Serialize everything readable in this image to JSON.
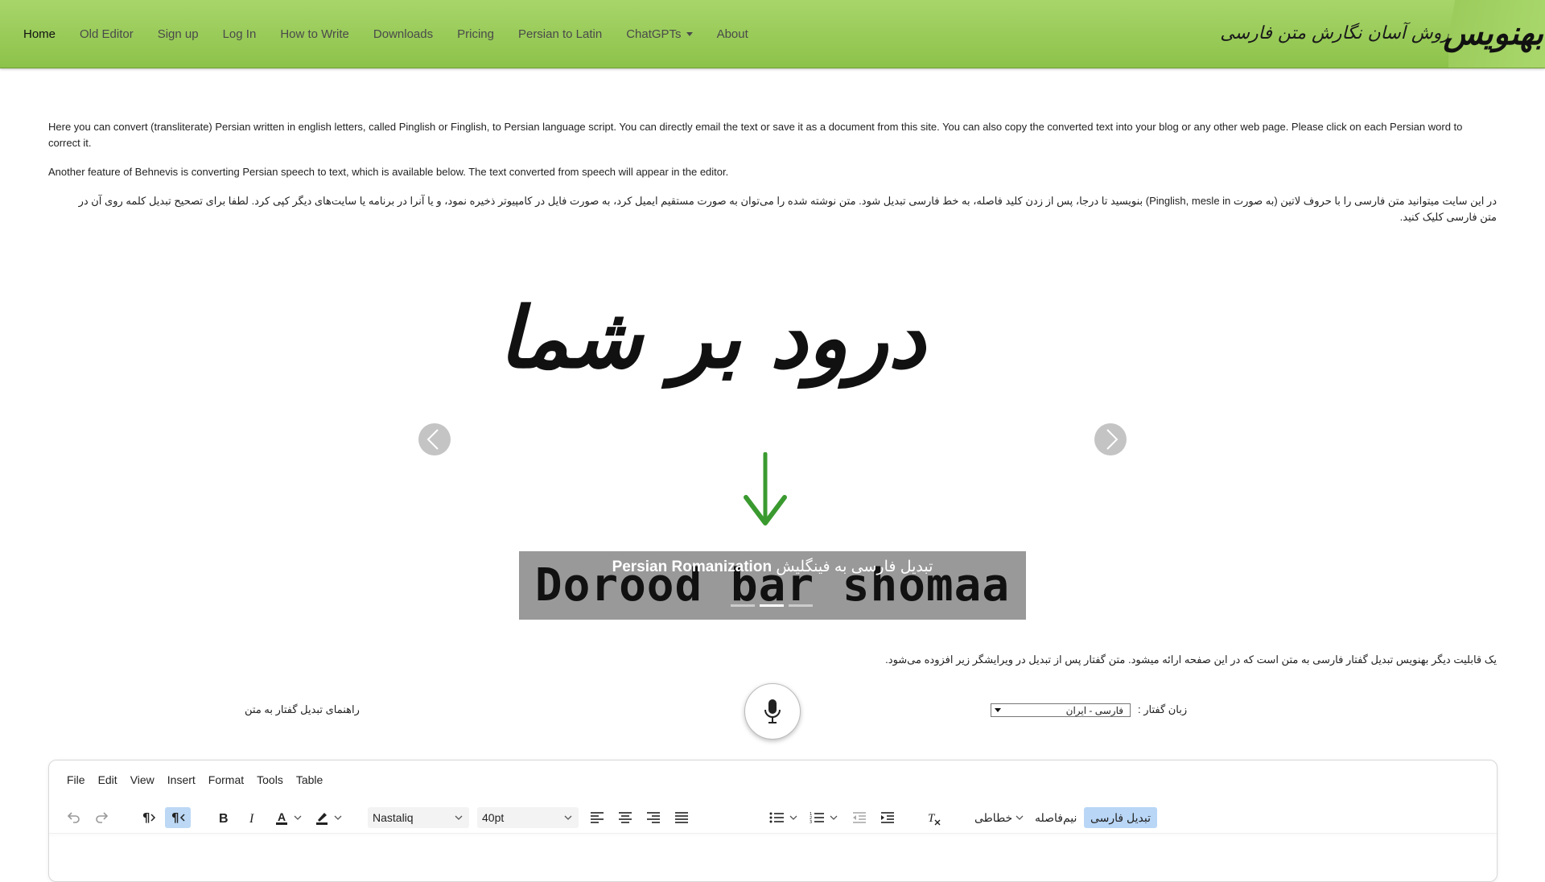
{
  "nav": {
    "items": [
      {
        "label": "Home",
        "active": true
      },
      {
        "label": "Old Editor"
      },
      {
        "label": "Sign up"
      },
      {
        "label": "Log In"
      },
      {
        "label": "How to Write"
      },
      {
        "label": "Downloads"
      },
      {
        "label": "Pricing"
      },
      {
        "label": "Persian to Latin"
      },
      {
        "label": "ChatGPTs"
      },
      {
        "label": "About"
      }
    ],
    "brand_tagline": "روش آسان نگارش متن فارسی",
    "brand_logo": "بهنویس"
  },
  "intro": {
    "en_paragraph_1": "Here you can convert (transliterate) Persian written in english letters, called Pinglish or Finglish, to Persian language script. You can directly email the text or save it as a document from this site. You can also copy the converted text into your blog or any other web page. Please click on each Persian word to correct it.",
    "en_paragraph_2": "Another feature of Behnevis is converting Persian speech to text, which is available below. The text converted from speech will appear in the editor.",
    "fa_paragraph": "در این سایت میتوانید متن فارسی را با حروف لاتین (به صورت Pinglish, mesle in) بنویسید تا درجا، پس از زدن کلید فاصله، به خط فارسی تبدیل شود. متن نوشته شده را می‌توان به صورت مستقیم ایمیل کرد، به صورت فایل در کامپیوتر ذخیره نمود، و یا آنرا در برنامه یا سایت‌های دیگر کپی کرد. لطفا برای تصحیح تبدیل کلمه روی آن در متن فارسی کلیک کنید."
  },
  "carousel": {
    "slide_phrase_persian": "درود بر شما",
    "slide_phrase_romanized": "Dorood bar shomaa",
    "caption_latin": "Persian Romanization",
    "caption_persian": "تبدیل فارسی به فینگلیش",
    "active_index": 1,
    "slide_count": 3
  },
  "speech": {
    "note": "یک قابلیت دیگر بهنویس تبدیل گفتار فارسی به متن است که در این صفحه ارائه میشود. متن گفتار پس از تبدیل در ویرایشگر زیر افزوده می‌شود.",
    "guide_link": "راهنمای تبدیل گفتار به متن",
    "language_label": "زبان گفتار :",
    "language_value": "فارسی - ایران"
  },
  "editor": {
    "menu": [
      "File",
      "Edit",
      "View",
      "Insert",
      "Format",
      "Tools",
      "Table"
    ],
    "font_family": "Nastaliq",
    "font_size": "40pt",
    "font_style_menu": "خطاطی",
    "half_space_button": "نیم‌فاصله",
    "convert_button": "تبدیل فارسی"
  },
  "colors": {
    "navbar": "#9ccb5a",
    "arrow_green": "#3a9a2f",
    "caption_bg": "#999999",
    "toolbar_active": "#b9d6f6"
  }
}
